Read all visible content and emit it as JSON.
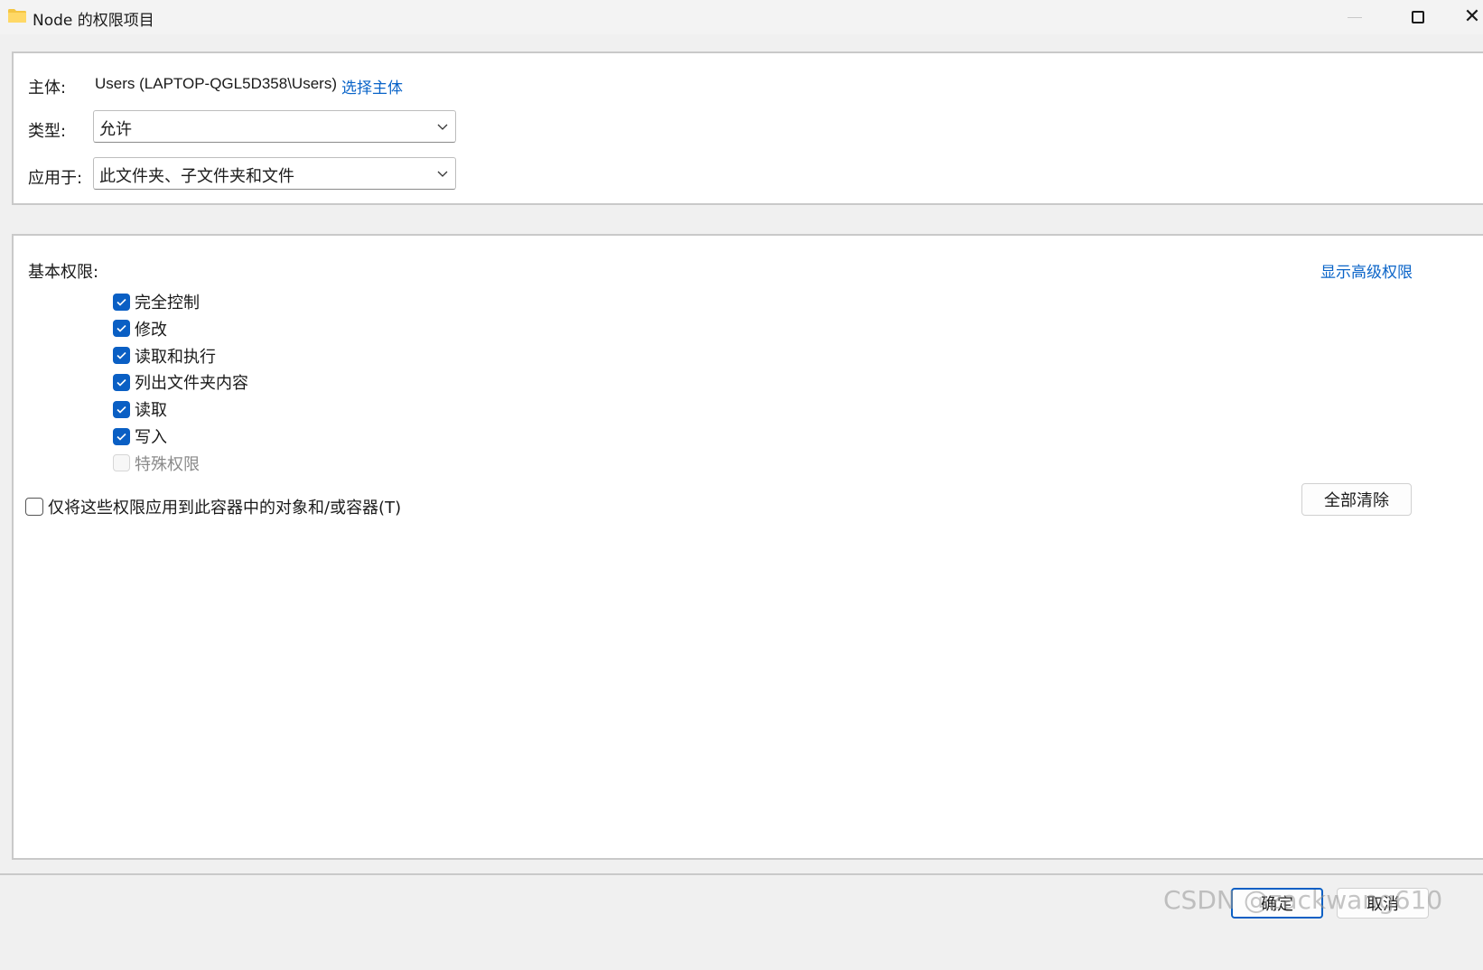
{
  "window": {
    "title": "Node 的权限项目",
    "icon": "folder-icon"
  },
  "principal": {
    "label": "主体:",
    "value": "Users (LAPTOP-QGL5D358\\Users)",
    "select_link": "选择主体"
  },
  "type": {
    "label": "类型:",
    "selected": "允许"
  },
  "applies_to": {
    "label": "应用于:",
    "selected": "此文件夹、子文件夹和文件"
  },
  "permissions": {
    "heading": "基本权限:",
    "advanced_link": "显示高级权限",
    "items": [
      {
        "label": "完全控制",
        "checked": true,
        "disabled": false
      },
      {
        "label": "修改",
        "checked": true,
        "disabled": false
      },
      {
        "label": "读取和执行",
        "checked": true,
        "disabled": false
      },
      {
        "label": "列出文件夹内容",
        "checked": true,
        "disabled": false
      },
      {
        "label": "读取",
        "checked": true,
        "disabled": false
      },
      {
        "label": "写入",
        "checked": true,
        "disabled": false
      },
      {
        "label": "特殊权限",
        "checked": false,
        "disabled": true
      }
    ],
    "apply_only_label": "仅将这些权限应用到此容器中的对象和/或容器(T)",
    "apply_only_checked": false,
    "clear_all_label": "全部清除"
  },
  "footer": {
    "ok_label": "确定",
    "cancel_label": "取消",
    "watermark": "CSDN @zackwang610"
  },
  "colors": {
    "accent": "#0a5fc4",
    "link": "#0a64c8",
    "panel_border": "#c9c9c9",
    "background": "#f0f0f0"
  }
}
